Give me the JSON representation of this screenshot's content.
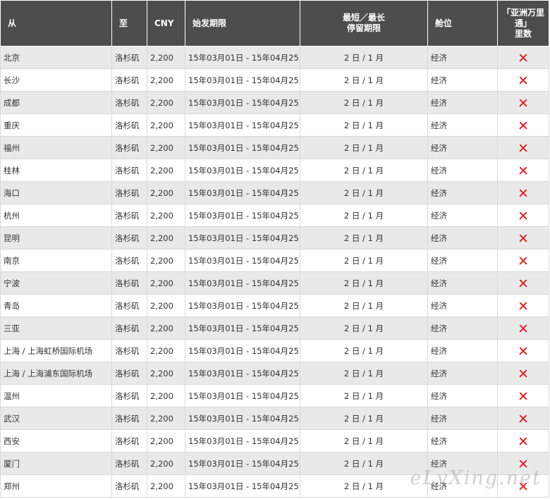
{
  "headers": {
    "from": "从",
    "to": "至",
    "cny": "CNY",
    "period": "始发期限",
    "stay": "最短／最长\n停留期限",
    "cabin": "舱位",
    "miles": "「亚洲万里通」\n里数"
  },
  "rows": [
    {
      "from": "北京",
      "to": "洛杉矶",
      "cny": "2,200",
      "period": "15年03月01日 - 15年04月25日",
      "stay": "2 日 / 1 月",
      "cabin": "经济",
      "miles": "cross-icon"
    },
    {
      "from": "长沙",
      "to": "洛杉矶",
      "cny": "2,200",
      "period": "15年03月01日 - 15年04月25日",
      "stay": "2 日 / 1 月",
      "cabin": "经济",
      "miles": "cross-icon"
    },
    {
      "from": "成都",
      "to": "洛杉矶",
      "cny": "2,200",
      "period": "15年03月01日 - 15年04月25日",
      "stay": "2 日 / 1 月",
      "cabin": "经济",
      "miles": "cross-icon"
    },
    {
      "from": "重庆",
      "to": "洛杉矶",
      "cny": "2,200",
      "period": "15年03月01日 - 15年04月25日",
      "stay": "2 日 / 1 月",
      "cabin": "经济",
      "miles": "cross-icon"
    },
    {
      "from": "福州",
      "to": "洛杉矶",
      "cny": "2,200",
      "period": "15年03月01日 - 15年04月25日",
      "stay": "2 日 / 1 月",
      "cabin": "经济",
      "miles": "cross-icon"
    },
    {
      "from": "桂林",
      "to": "洛杉矶",
      "cny": "2,200",
      "period": "15年03月01日 - 15年04月25日",
      "stay": "2 日 / 1 月",
      "cabin": "经济",
      "miles": "cross-icon"
    },
    {
      "from": "海口",
      "to": "洛杉矶",
      "cny": "2,200",
      "period": "15年03月01日 - 15年04月25日",
      "stay": "2 日 / 1 月",
      "cabin": "经济",
      "miles": "cross-icon"
    },
    {
      "from": "杭州",
      "to": "洛杉矶",
      "cny": "2,200",
      "period": "15年03月01日 - 15年04月25日",
      "stay": "2 日 / 1 月",
      "cabin": "经济",
      "miles": "cross-icon"
    },
    {
      "from": "昆明",
      "to": "洛杉矶",
      "cny": "2,200",
      "period": "15年03月01日 - 15年04月25日",
      "stay": "2 日 / 1 月",
      "cabin": "经济",
      "miles": "cross-icon"
    },
    {
      "from": "南京",
      "to": "洛杉矶",
      "cny": "2,200",
      "period": "15年03月01日 - 15年04月25日",
      "stay": "2 日 / 1 月",
      "cabin": "经济",
      "miles": "cross-icon"
    },
    {
      "from": "宁波",
      "to": "洛杉矶",
      "cny": "2,200",
      "period": "15年03月01日 - 15年04月25日",
      "stay": "2 日 / 1 月",
      "cabin": "经济",
      "miles": "cross-icon"
    },
    {
      "from": "青岛",
      "to": "洛杉矶",
      "cny": "2,200",
      "period": "15年03月01日 - 15年04月25日",
      "stay": "2 日 / 1 月",
      "cabin": "经济",
      "miles": "cross-icon"
    },
    {
      "from": "三亚",
      "to": "洛杉矶",
      "cny": "2,200",
      "period": "15年03月01日 - 15年04月25日",
      "stay": "2 日 / 1 月",
      "cabin": "经济",
      "miles": "cross-icon"
    },
    {
      "from": "上海 / 上海虹桥国际机场",
      "to": "洛杉矶",
      "cny": "2,200",
      "period": "15年03月01日 - 15年04月25日",
      "stay": "2 日 / 1 月",
      "cabin": "经济",
      "miles": "cross-icon"
    },
    {
      "from": "上海 / 上海浦东国际机场",
      "to": "洛杉矶",
      "cny": "2,200",
      "period": "15年03月01日 - 15年04月25日",
      "stay": "2 日 / 1 月",
      "cabin": "经济",
      "miles": "cross-icon"
    },
    {
      "from": "温州",
      "to": "洛杉矶",
      "cny": "2,200",
      "period": "15年03月01日 - 15年04月25日",
      "stay": "2 日 / 1 月",
      "cabin": "经济",
      "miles": "cross-icon"
    },
    {
      "from": "武汉",
      "to": "洛杉矶",
      "cny": "2,200",
      "period": "15年03月01日 - 15年04月25日",
      "stay": "2 日 / 1 月",
      "cabin": "经济",
      "miles": "cross-icon"
    },
    {
      "from": "西安",
      "to": "洛杉矶",
      "cny": "2,200",
      "period": "15年03月01日 - 15年04月25日",
      "stay": "2 日 / 1 月",
      "cabin": "经济",
      "miles": "cross-icon"
    },
    {
      "from": "厦门",
      "to": "洛杉矶",
      "cny": "2,200",
      "period": "15年03月01日 - 15年04月25日",
      "stay": "2 日 / 1 月",
      "cabin": "经济",
      "miles": "cross-icon"
    },
    {
      "from": "郑州",
      "to": "洛杉矶",
      "cny": "2,200",
      "period": "15年03月01日 - 15年04月25日",
      "stay": "2 日 / 1 月",
      "cabin": "经济",
      "miles": "cross-icon"
    }
  ],
  "watermark": "eLvXing.net",
  "colors": {
    "header_bg": "#4d4d4d",
    "row_alt_bg": "#e9e9ea",
    "cross": "#d8232a"
  }
}
